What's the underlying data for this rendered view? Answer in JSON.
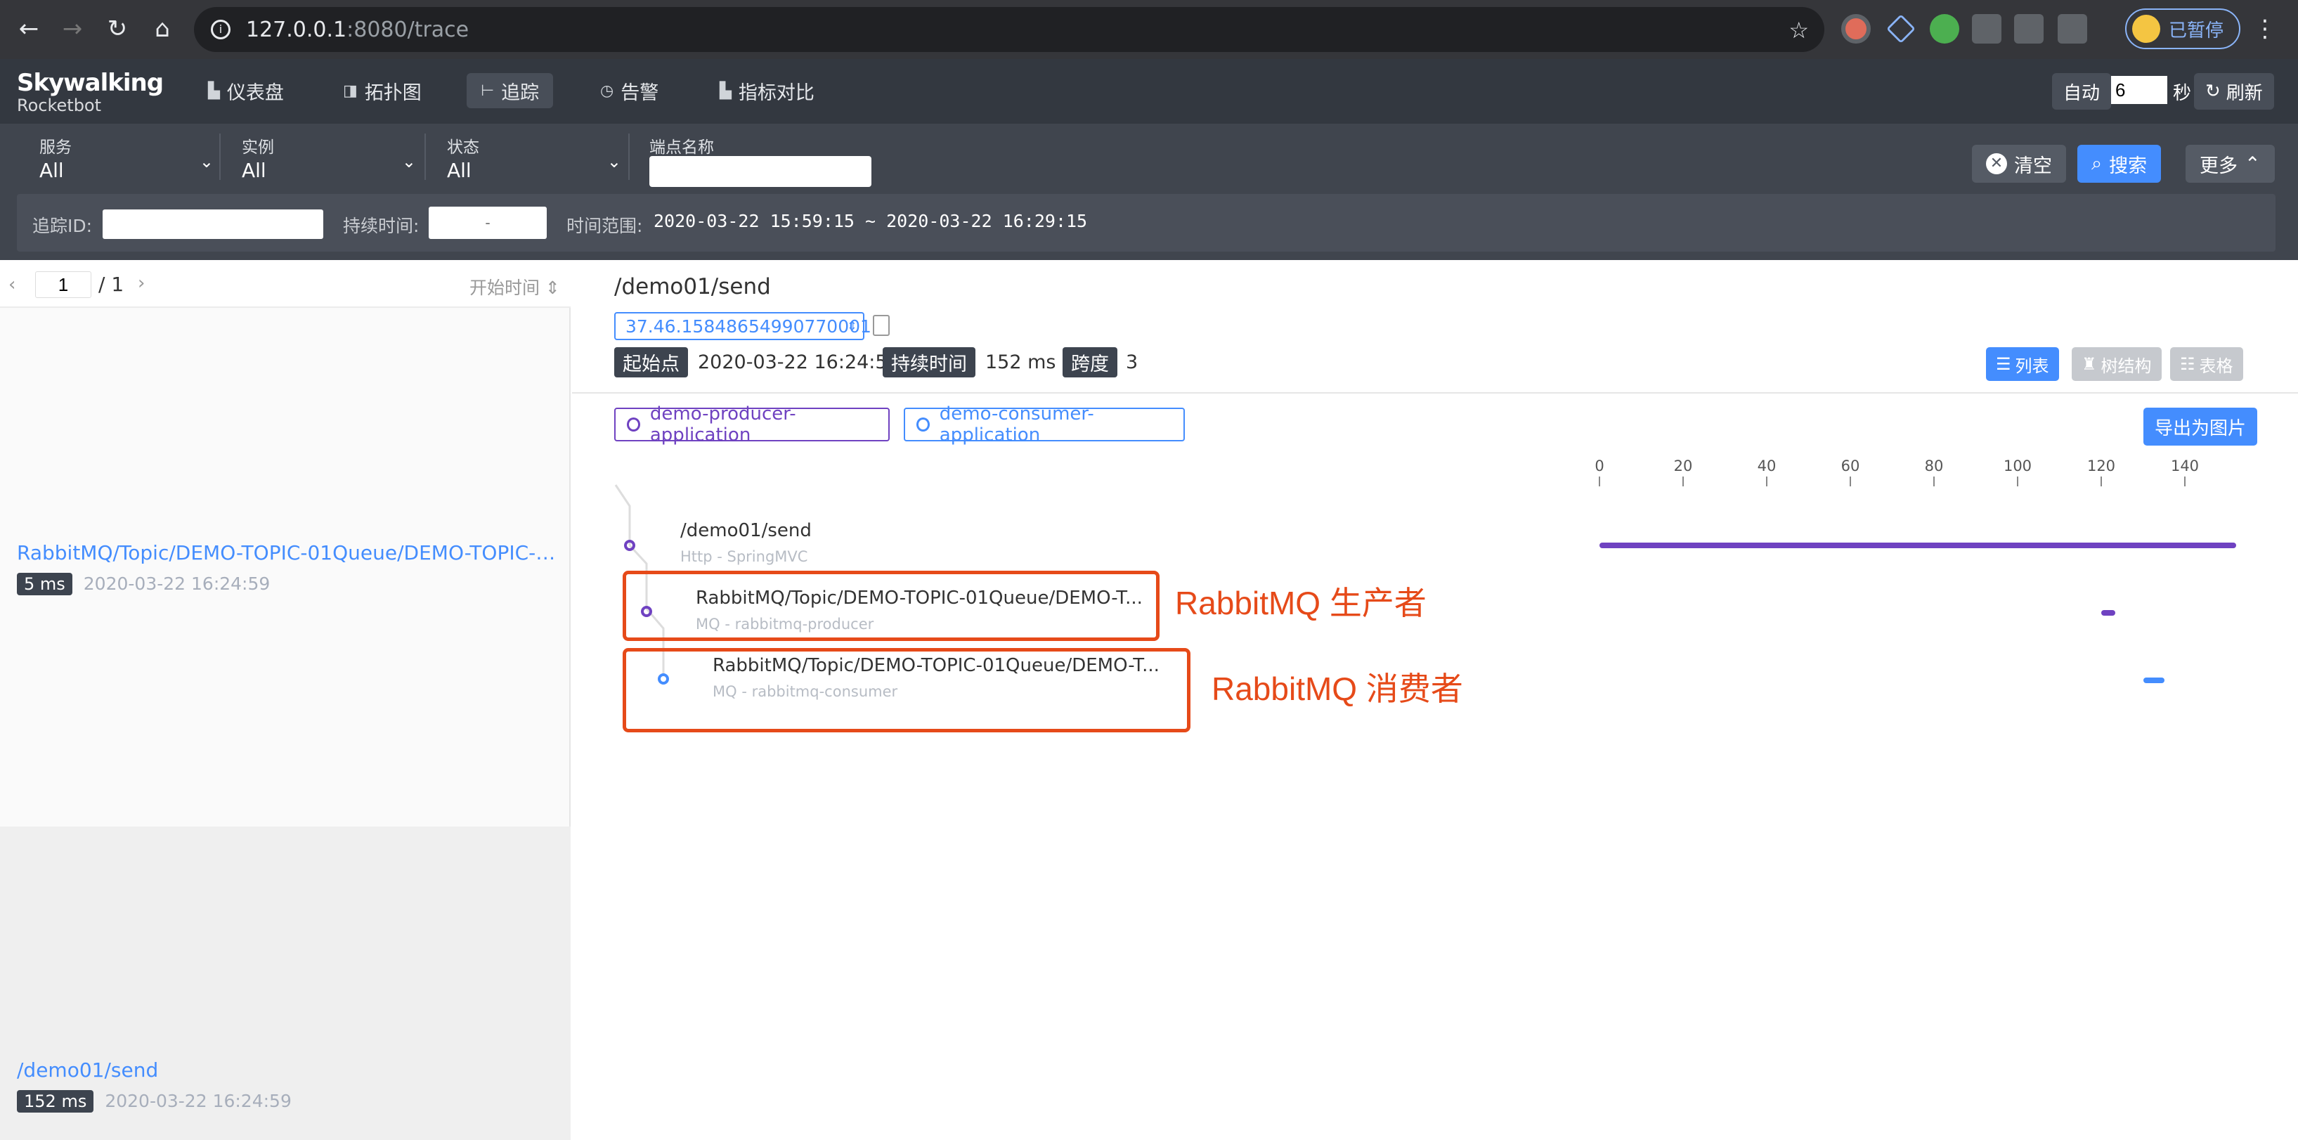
{
  "browser": {
    "url_host": "127.0.0.1",
    "url_rest": ":8080/trace",
    "profile_label": "已暂停"
  },
  "app": {
    "logo_line1": "Skywalking",
    "logo_line2": "Rocketbot",
    "menu": [
      {
        "label": "仪表盘",
        "icon": "chart-icon"
      },
      {
        "label": "拓扑图",
        "icon": "topology-icon"
      },
      {
        "label": "追踪",
        "icon": "trace-icon",
        "active": true
      },
      {
        "label": "告警",
        "icon": "alarm-icon"
      },
      {
        "label": "指标对比",
        "icon": "compare-icon"
      }
    ],
    "auto_label": "自动",
    "interval_value": "6",
    "sec_label": "秒",
    "refresh_label": "刷新"
  },
  "filters": {
    "service": {
      "label": "服务",
      "value": "All"
    },
    "instance": {
      "label": "实例",
      "value": "All"
    },
    "status": {
      "label": "状态",
      "value": "All"
    },
    "endpoint_label": "端点名称",
    "clear_label": "清空",
    "search_label": "搜索",
    "more_label": "更多",
    "trace_id_label": "追踪ID:",
    "duration_label": "持续时间:",
    "duration_placeholder": "-",
    "time_range_label": "时间范围:",
    "time_range_value": "2020-03-22 15:59:15 ~ 2020-03-22 16:29:15"
  },
  "list": {
    "page": "1",
    "page_total": "/ 1",
    "sort_label": "开始时间",
    "items": [
      {
        "name": "RabbitMQ/Topic/DEMO-TOPIC-01Queue/DEMO-TOPIC-01/...",
        "duration": "5 ms",
        "time": "2020-03-22 16:24:59"
      },
      {
        "name": "/demo01/send",
        "duration": "152 ms",
        "time": "2020-03-22 16:24:59"
      }
    ]
  },
  "detail": {
    "title": "/demo01/send",
    "trace_id": "37.46.15848654990770001",
    "start_label": "起始点",
    "start_value": "2020-03-22 16:24:59",
    "duration_label": "持续时间",
    "duration_value": "152 ms",
    "span_label": "跨度",
    "span_value": "3",
    "view_list": "列表",
    "view_tree": "树结构",
    "view_table": "表格",
    "services": [
      "demo-producer-application",
      "demo-consumer-application"
    ],
    "export_label": "导出为图片",
    "axis_ticks": [
      "0",
      "20",
      "40",
      "60",
      "80",
      "100",
      "120",
      "140"
    ],
    "spans": [
      {
        "name": "/demo01/send",
        "sub": "Http - SpringMVC"
      },
      {
        "name": "RabbitMQ/Topic/DEMO-TOPIC-01Queue/DEMO-T...",
        "sub": "MQ - rabbitmq-producer"
      },
      {
        "name": "RabbitMQ/Topic/DEMO-TOPIC-01Queue/DEMO-T...",
        "sub": "MQ - rabbitmq-consumer"
      }
    ],
    "annotations": [
      "RabbitMQ 生产者",
      "RabbitMQ 消费者"
    ]
  },
  "colors": {
    "producer": "#6f42c1",
    "consumer": "#448dfe",
    "annotation": "#e64a19",
    "accent": "#448dfe"
  }
}
